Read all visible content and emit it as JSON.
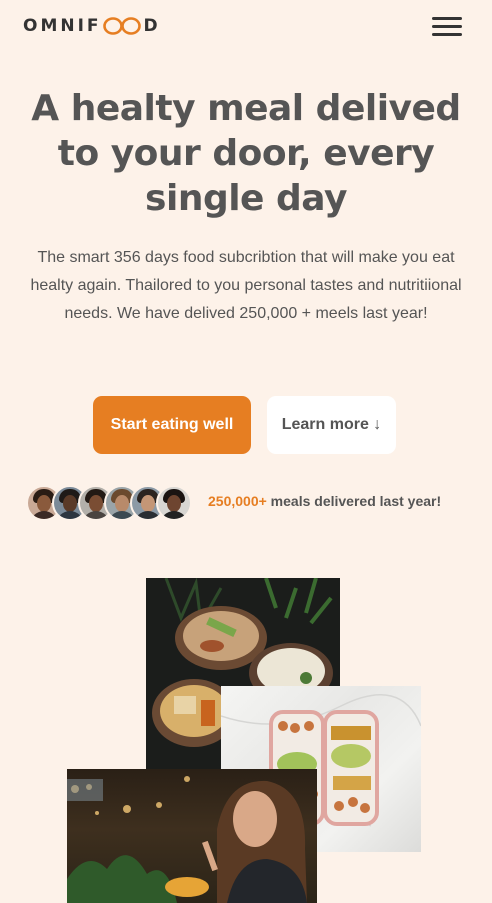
{
  "header": {
    "logo_left": "OMNIF",
    "logo_right": "D"
  },
  "hero": {
    "title": "A healty meal delived to your door, every single day",
    "description": "The smart 356 days food subcribtion that will make you eat healty again. Thailored to you personal tastes and nutritiional needs. We have delived 250,000 + meels last year!",
    "primary_button": "Start eating well",
    "secondary_button": "Learn more ↓"
  },
  "delivered": {
    "count": "250,000+",
    "text": " meals delivered last year!"
  },
  "colors": {
    "accent": "#e67e22",
    "background": "#fdf2e9",
    "text": "#555555"
  },
  "icons": [
    "infinity-icon",
    "menu-icon"
  ]
}
